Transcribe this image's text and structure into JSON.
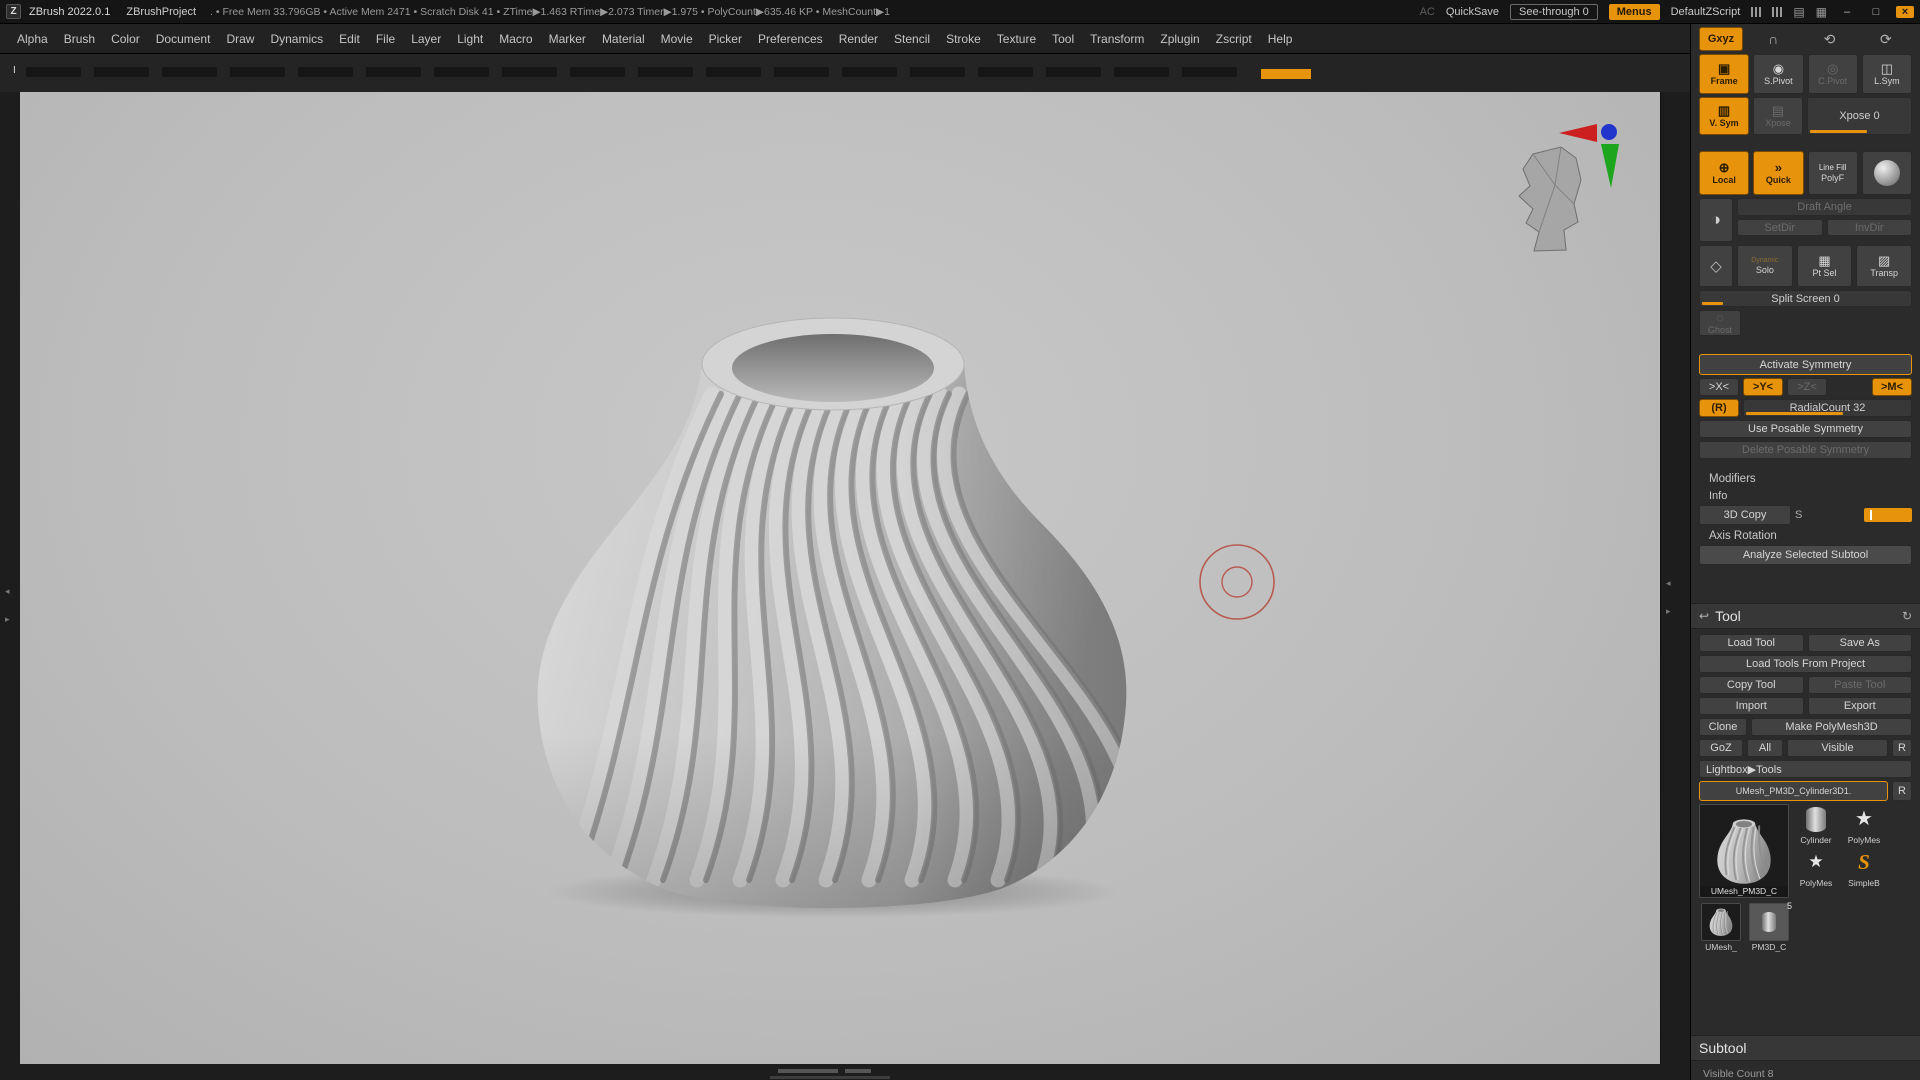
{
  "titlebar": {
    "app_title": "ZBrush 2022.0.1",
    "project": "ZBrushProject",
    "stats": ". • Free Mem 33.796GB • Active Mem 2471 • Scratch Disk 41 • ZTime▶1.463 RTime▶2.073 Timer▶1.975 • PolyCount▶635.46 KP • MeshCount▶1",
    "ac": "AC",
    "quicksave": "QuickSave",
    "see_through": "See-through 0",
    "menus": "Menus",
    "default_zscript": "DefaultZScript",
    "minimize": "–",
    "maximize": "□",
    "close": "×"
  },
  "menubar": {
    "items": [
      "Alpha",
      "Brush",
      "Color",
      "Document",
      "Draw",
      "Dynamics",
      "Edit",
      "File",
      "Layer",
      "Light",
      "Macro",
      "Marker",
      "Material",
      "Movie",
      "Picker",
      "Preferences",
      "Render",
      "Stencil",
      "Stroke",
      "Texture",
      "Tool",
      "Transform",
      "Zplugin",
      "Zscript",
      "Help"
    ]
  },
  "tabstrip": {
    "marker": "I"
  },
  "shelf": {
    "gxyz": "Gxyz",
    "frame": "Frame",
    "s_pivot": "S.Pivot",
    "c_pivot": "C.Pivot",
    "l_sym": "L.Sym",
    "v_sym": "V. Sym",
    "xpose": "Xpose",
    "xpose_slider": "Xpose 0",
    "local": "Local",
    "quick": "Quick",
    "line_fill": "Line Fill",
    "polyf": "PolyF",
    "draft_angle": "Draft Angle",
    "setdir": "SetDir",
    "invdir": "InvDir",
    "dynamic": "Dynamic",
    "solo": "Solo",
    "pt_sel": "Pt Sel",
    "transp": "Transp",
    "split_screen": "Split Screen 0",
    "ghost": "Ghost"
  },
  "symmetry": {
    "activate": "Activate Symmetry",
    "x": ">X<",
    "y": ">Y<",
    "z": ">Z<",
    "m": ">M<",
    "r": "(R)",
    "radial_count": "RadialCount 32",
    "use_posable": "Use Posable Symmetry",
    "delete_posable": "Delete Posable Symmetry"
  },
  "modifiers": {
    "title": "Modifiers",
    "info": "Info",
    "copy_3d": "3D Copy",
    "s": "S",
    "axis_rotation": "Axis Rotation",
    "analyze": "Analyze Selected Subtool"
  },
  "tool": {
    "title": "Tool",
    "load_tool": "Load Tool",
    "save_as": "Save As",
    "load_tools_from_project": "Load Tools From Project",
    "copy_tool": "Copy Tool",
    "paste_tool": "Paste Tool",
    "import": "Import",
    "export": "Export",
    "clone": "Clone",
    "make_polymesh3d": "Make PolyMesh3D",
    "goz": "GoZ",
    "all": "All",
    "visible": "Visible",
    "r": "R",
    "lightbox_tools": "Lightbox▶Tools",
    "active_tool": "UMesh_PM3D_Cylinder3D1.",
    "r2": "R",
    "active_thumb_label": "UMesh_PM3D_C",
    "thumb1_label": "Cylinder",
    "thumb2_label": "PolyMes",
    "thumb3_label": "PolyMes",
    "thumb4_label": "SimpleB",
    "small_thumb1_label": "UMesh_",
    "small_thumb2_label": "PM3D_C",
    "badge": "5"
  },
  "subtool": {
    "title": "Subtool",
    "visible_count": "Visible Count 8"
  },
  "colors": {
    "accent": "#e8930c",
    "canvas_bg": "#bcbcbc"
  }
}
